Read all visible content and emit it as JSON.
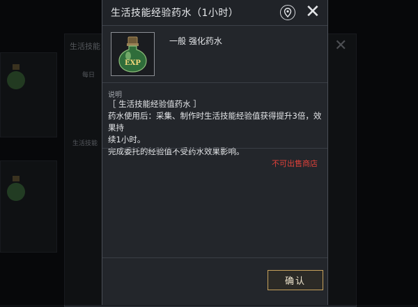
{
  "background": {
    "title_partial": "生活技能",
    "label_daily": "每日",
    "label_skill": "生活技能"
  },
  "dialog": {
    "title": "生活技能经验药水（1小时）",
    "item": {
      "icon_text": "EXP",
      "grade": "一般 强化药水"
    },
    "description": {
      "label": "说明",
      "lines": [
        "［ 生活技能经验值药水 ］",
        "药水使用后：采集、制作时生活技能经验值获得提升3倍，效果持",
        "续1小时。",
        "完成委托的经验值不受药水效果影响。"
      ]
    },
    "restriction": "不可出售商店",
    "confirm_label": "确认"
  },
  "colors": {
    "restriction_red": "#e0413a",
    "confirm_border_gold": "#c7a25c",
    "modal_bg": "#23262b"
  },
  "icons": {
    "pin": "location-pin-icon",
    "close": "close-icon",
    "potion": "exp-potion-icon"
  }
}
